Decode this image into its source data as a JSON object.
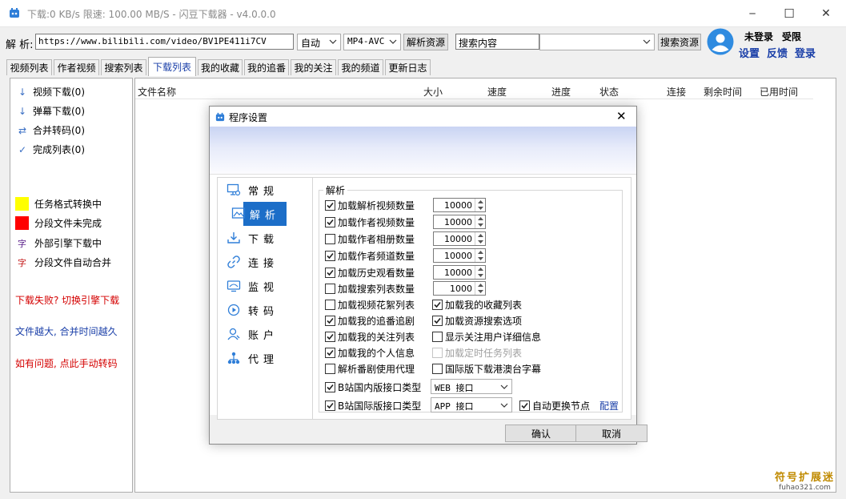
{
  "window": {
    "title": "下载:0 KB/s  限速: 100.00 MB/S  - 闪豆下载器 - v4.0.0.0",
    "minimize": "─",
    "maximize": "☐",
    "close": "✕"
  },
  "toolbar": {
    "parse_label": "解 析:",
    "url_value": "https://www.bilibili.com/video/BV1PE411i7CV",
    "mode_select": "自动",
    "format_select": "MP4-AVC",
    "parse_button": "解析资源",
    "search_value": "搜索内容",
    "search_type_select": "",
    "search_button": "搜索资源"
  },
  "user": {
    "status": "未登录",
    "limited": "受限",
    "settings": "设置",
    "feedback": "反馈",
    "login": "登录"
  },
  "tabs": [
    {
      "label": "视频列表"
    },
    {
      "label": "作者视频"
    },
    {
      "label": "搜索列表"
    },
    {
      "label": "下载列表"
    },
    {
      "label": "我的收藏"
    },
    {
      "label": "我的追番"
    },
    {
      "label": "我的关注"
    },
    {
      "label": "我的频道"
    },
    {
      "label": "更新日志"
    }
  ],
  "left_nav": [
    {
      "label": "视频下载(0)",
      "icon": "↓"
    },
    {
      "label": "弹幕下载(0)",
      "icon": "↓"
    },
    {
      "label": "合并转码(0)",
      "icon": "⇄"
    },
    {
      "label": "完成列表(0)",
      "icon": "✓"
    }
  ],
  "legend": [
    {
      "label": "任务格式转换中",
      "color": "#ffff00"
    },
    {
      "label": "分段文件未完成",
      "color": "#ff0000"
    },
    {
      "label": "外部引擎下载中",
      "glyph": "字"
    },
    {
      "label": "分段文件自动合并",
      "glyph": "字"
    }
  ],
  "notes": {
    "fail": "下载失败? 切换引擎下载",
    "big": "文件越大, 合并时间越久",
    "problem": "如有问题, 点此手动转码"
  },
  "columns": [
    "文件名称",
    "大小",
    "速度",
    "进度",
    "状态",
    "连接",
    "剩余时间",
    "已用时间"
  ],
  "dialog": {
    "title": "程序设置",
    "close": "✕",
    "nav": [
      {
        "label": "常规",
        "icon": "display-gear-icon"
      },
      {
        "label": "解析",
        "icon": "picture-icon"
      },
      {
        "label": "下载",
        "icon": "download-tray-icon"
      },
      {
        "label": "连接",
        "icon": "link-icon"
      },
      {
        "label": "监视",
        "icon": "monitor-icon"
      },
      {
        "label": "转码",
        "icon": "transcode-icon"
      },
      {
        "label": "账户",
        "icon": "user-icon"
      },
      {
        "label": "代理",
        "icon": "network-icon"
      }
    ],
    "group_title": "解析",
    "numeric_options": [
      {
        "label": "加载解析视频数量",
        "checked": true,
        "value": "10000"
      },
      {
        "label": "加载作者视频数量",
        "checked": true,
        "value": "10000"
      },
      {
        "label": "加载作者相册数量",
        "checked": false,
        "value": "10000"
      },
      {
        "label": "加载作者频道数量",
        "checked": true,
        "value": "10000"
      },
      {
        "label": "加载历史观看数量",
        "checked": true,
        "value": "10000"
      },
      {
        "label": "加载搜索列表数量",
        "checked": false,
        "value": "1000"
      }
    ],
    "left_options": [
      {
        "label": "加载视频花絮列表",
        "checked": false
      },
      {
        "label": "加载我的追番追剧",
        "checked": true
      },
      {
        "label": "加载我的关注列表",
        "checked": true
      },
      {
        "label": "加载我的个人信息",
        "checked": true
      },
      {
        "label": "解析番剧使用代理",
        "checked": false
      }
    ],
    "right_options": [
      {
        "label": "加载我的收藏列表",
        "checked": true,
        "disabled": false
      },
      {
        "label": "加载资源搜索选项",
        "checked": true,
        "disabled": false
      },
      {
        "label": "显示关注用户详细信息",
        "checked": false,
        "disabled": false
      },
      {
        "label": "加载定时任务列表",
        "checked": false,
        "disabled": true
      },
      {
        "label": "国际版下载港澳台字幕",
        "checked": false,
        "disabled": false
      }
    ],
    "api_domestic": {
      "label": "B站国内版接口类型",
      "checked": true,
      "value": "WEB 接口"
    },
    "api_intl": {
      "label": "B站国际版接口类型",
      "checked": true,
      "value": "APP 接口"
    },
    "auto_switch": {
      "label": "自动更换节点",
      "checked": true
    },
    "config_link": "配置",
    "ok": "确认",
    "cancel": "取消"
  },
  "watermark": {
    "main": "符号扩展迷",
    "sub": "fuhao321.com"
  },
  "colors": {
    "accent": "#1c6ec8",
    "link": "#1a3fa8",
    "red_note": "#d40000"
  }
}
